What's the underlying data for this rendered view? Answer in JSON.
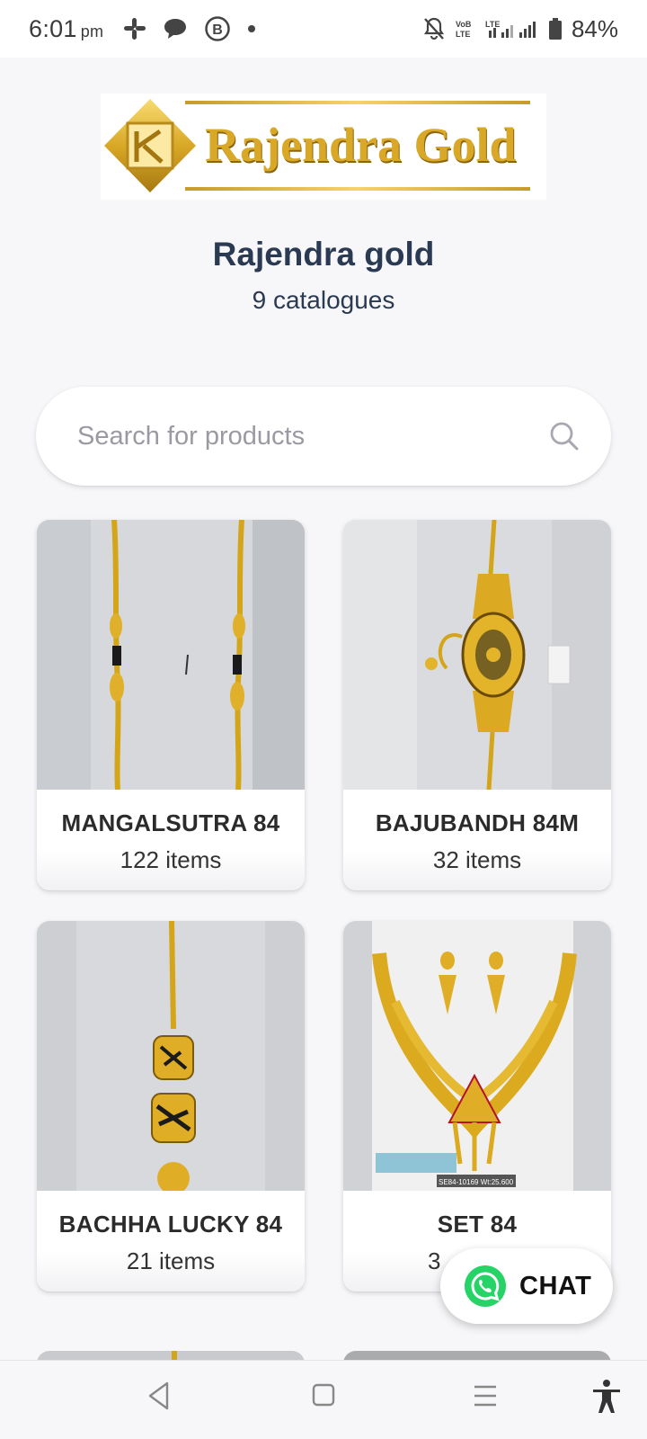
{
  "status_bar": {
    "time": "6:01",
    "ampm": "pm",
    "battery": "84%"
  },
  "store": {
    "logo_text": "Rajendra Gold",
    "name": "Rajendra gold",
    "catalogue_count": "9 catalogues"
  },
  "search": {
    "placeholder": "Search for products"
  },
  "catalogues": [
    {
      "name": "MANGALSUTRA 84",
      "count": "122 items"
    },
    {
      "name": "BAJUBANDH 84M",
      "count": "32 items"
    },
    {
      "name": "BACHHA LUCKY 84",
      "count": "21 items"
    },
    {
      "name": "SET 84",
      "count": "3"
    }
  ],
  "product_tag": "SE84-10169 Wt:25.600",
  "chat": {
    "label": "CHAT"
  },
  "colors": {
    "title": "#2a3a52",
    "gold": "#d9a826",
    "whatsapp": "#25d366"
  }
}
